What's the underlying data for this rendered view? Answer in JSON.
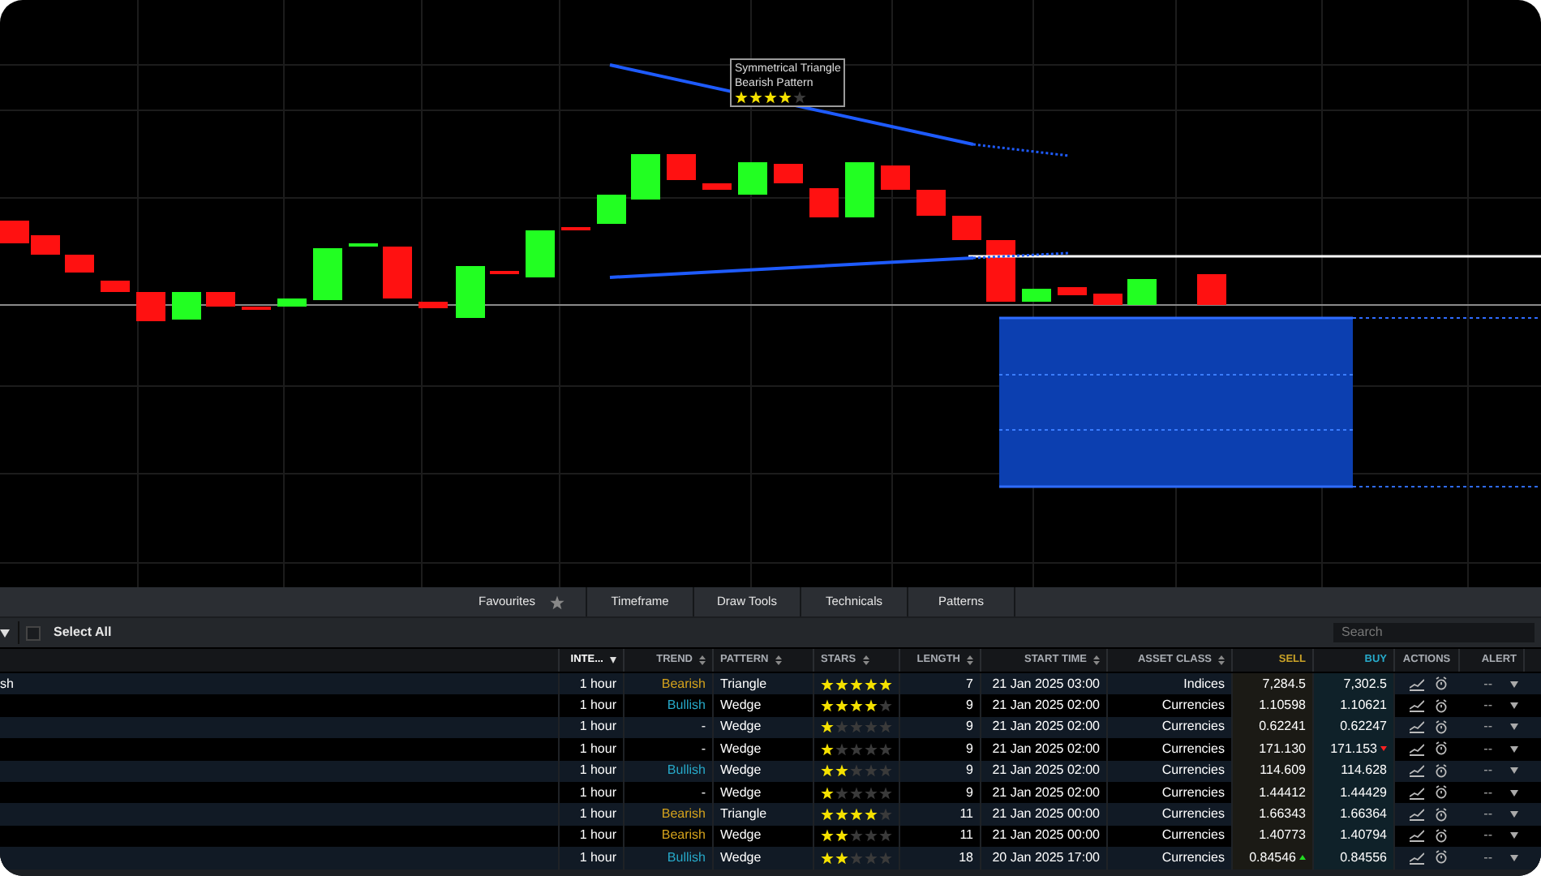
{
  "chart": {
    "tooltip": {
      "title": "Symmetrical Triangle",
      "subtitle": "Bearish Pattern",
      "stars": 4
    }
  },
  "tabs": [
    {
      "label": "Favourites",
      "star": true
    },
    {
      "label": "Timeframe",
      "star": false
    },
    {
      "label": "Draw Tools",
      "star": false
    },
    {
      "label": "Technicals",
      "star": false
    },
    {
      "label": "Patterns",
      "star": false
    }
  ],
  "toolbar": {
    "select_all": {
      "label": "Select All",
      "checked": false
    },
    "search": {
      "placeholder": "Search"
    }
  },
  "table": {
    "columns": [
      "",
      "INTE...",
      "TREND",
      "PATTERN",
      "STARS",
      "LENGTH",
      "START TIME",
      "ASSET CLASS",
      "SELL",
      "BUY",
      "ACTIONS",
      "ALERT"
    ],
    "rows": [
      {
        "column_1": "sh",
        "interval": "1 hour",
        "trend": {
          "text": "Bearish",
          "kind": "bearish"
        },
        "pattern": "Triangle",
        "stars": 5,
        "length": "7",
        "start_time": "21 Jan 2025 03:00",
        "asset_class": "Indices",
        "sell": "7,284.5",
        "sell_up": false,
        "buy": "7,302.5",
        "buy_down": false,
        "alert": "--"
      },
      {
        "interval": "1 hour",
        "trend": {
          "text": "Bullish",
          "kind": "bullish"
        },
        "pattern": "Wedge",
        "stars": 4,
        "length": "9",
        "start_time": "21 Jan 2025 02:00",
        "asset_class": "Currencies",
        "sell": "1.10598",
        "sell_up": false,
        "buy": "1.10621",
        "buy_down": false,
        "alert": "--"
      },
      {
        "interval": "1 hour",
        "trend": {
          "text": "-",
          "kind": "neutral"
        },
        "pattern": "Wedge",
        "stars": 1,
        "length": "9",
        "start_time": "21 Jan 2025 02:00",
        "asset_class": "Currencies",
        "sell": "0.62241",
        "sell_up": false,
        "buy": "0.62247",
        "buy_down": false,
        "alert": "--"
      },
      {
        "interval": "1 hour",
        "trend": {
          "text": "-",
          "kind": "neutral"
        },
        "pattern": "Wedge",
        "stars": 1,
        "length": "9",
        "start_time": "21 Jan 2025 02:00",
        "asset_class": "Currencies",
        "sell": "171.130",
        "sell_up": false,
        "buy": "171.153",
        "buy_down": true,
        "alert": "--"
      },
      {
        "interval": "1 hour",
        "trend": {
          "text": "Bullish",
          "kind": "bullish"
        },
        "pattern": "Wedge",
        "stars": 2,
        "length": "9",
        "start_time": "21 Jan 2025 02:00",
        "asset_class": "Currencies",
        "sell": "114.609",
        "sell_up": false,
        "buy": "114.628",
        "buy_down": false,
        "alert": "--"
      },
      {
        "interval": "1 hour",
        "trend": {
          "text": "-",
          "kind": "neutral"
        },
        "pattern": "Wedge",
        "stars": 1,
        "length": "9",
        "start_time": "21 Jan 2025 02:00",
        "asset_class": "Currencies",
        "sell": "1.44412",
        "sell_up": false,
        "buy": "1.44429",
        "buy_down": false,
        "alert": "--"
      },
      {
        "interval": "1 hour",
        "trend": {
          "text": "Bearish",
          "kind": "bearish"
        },
        "pattern": "Triangle",
        "stars": 4,
        "length": "11",
        "start_time": "21 Jan 2025 00:00",
        "asset_class": "Currencies",
        "sell": "1.66343",
        "sell_up": false,
        "buy": "1.66364",
        "buy_down": false,
        "alert": "--"
      },
      {
        "interval": "1 hour",
        "trend": {
          "text": "Bearish",
          "kind": "bearish"
        },
        "pattern": "Wedge",
        "stars": 2,
        "length": "11",
        "start_time": "21 Jan 2025 00:00",
        "asset_class": "Currencies",
        "sell": "1.40773",
        "sell_up": false,
        "buy": "1.40794",
        "buy_down": false,
        "alert": "--"
      },
      {
        "interval": "1 hour",
        "trend": {
          "text": "Bullish",
          "kind": "bullish"
        },
        "pattern": "Wedge",
        "stars": 2,
        "length": "18",
        "start_time": "20 Jan 2025 17:00",
        "asset_class": "Currencies",
        "sell": "0.84546",
        "sell_up": true,
        "buy": "0.84556",
        "buy_down": false,
        "alert": "--"
      }
    ]
  }
}
